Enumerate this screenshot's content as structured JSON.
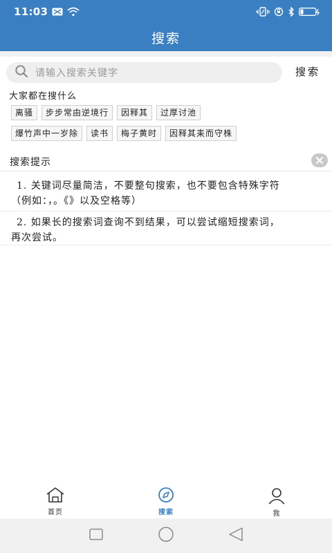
{
  "status_bar": {
    "time": "11:03",
    "icons": [
      "mail-icon",
      "wifi-icon",
      "vibrate-icon",
      "alarm-icon",
      "bluetooth-icon",
      "battery-icon"
    ]
  },
  "header": {
    "title": "搜索"
  },
  "search": {
    "placeholder": "请输入搜索关键字",
    "button_label": "搜索",
    "icon": "search-icon"
  },
  "hot": {
    "title": "大家都在搜什么",
    "row1": [
      "离骚",
      "步步常由逆境行",
      "因释其",
      "过厚讨池"
    ],
    "row2": [
      "爆竹声中一岁除",
      "读书",
      "梅子黄时",
      "因释其耒而守株"
    ]
  },
  "hints": {
    "title": "搜索提示",
    "tip1_line1": "1. 关键词尽量简洁，不要整句搜索，也不要包含特殊字符",
    "tip1_line2": "（例如：，。《》以及空格等）",
    "tip2_line1": "2. 如果长的搜索词查询不到结果，可以尝试缩短搜索词，",
    "tip2_line2": "再次尝试。"
  },
  "bottom_nav": {
    "items": [
      {
        "label": "首页",
        "icon": "home-icon",
        "active": false
      },
      {
        "label": "搜索",
        "icon": "compass-icon",
        "active": true
      },
      {
        "label": "我",
        "icon": "user-icon",
        "active": false
      }
    ]
  },
  "colors": {
    "primary": "#3a7fc2",
    "background": "#ffffff",
    "tag_border": "#cfcfcf"
  }
}
